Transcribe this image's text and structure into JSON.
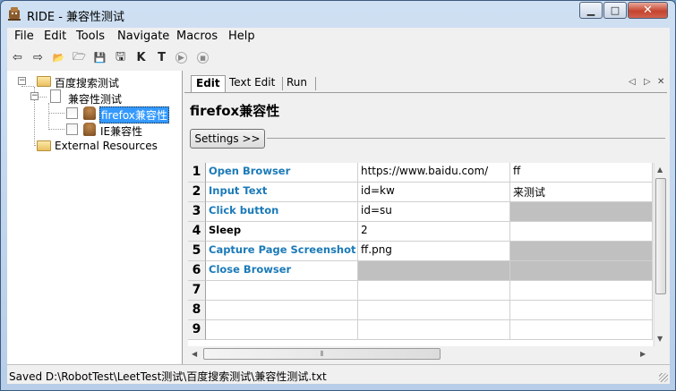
{
  "window": {
    "title": "RIDE - 兼容性测试",
    "min_glyph": "▁",
    "max_glyph": "□",
    "close_glyph": "✕"
  },
  "menu": [
    "File",
    "Edit",
    "Tools",
    "Navigate",
    "Macros",
    "Help"
  ],
  "toolbar": {
    "icons": [
      "back-arrow-icon",
      "forward-arrow-icon",
      "open-project-icon",
      "open-directory-icon",
      "save-icon",
      "save-all-icon",
      "search-keywords-icon",
      "search-tests-icon",
      "run-icon",
      "stop-icon"
    ],
    "glyphs": [
      "⇦",
      "⇨",
      "📂",
      "🗁",
      "💾",
      "🖫",
      "K",
      "T",
      "▶",
      "■"
    ]
  },
  "tree": {
    "root": "百度搜索测试",
    "suite": "兼容性测试",
    "tests": [
      "firefox兼容性",
      "IE兼容性"
    ],
    "external": "External Resources",
    "toggle_minus": "−"
  },
  "tabs": [
    "Edit",
    "Text Edit",
    "Run"
  ],
  "tab_nav": [
    "◁",
    "▷",
    "✕"
  ],
  "editor": {
    "title": "firefox兼容性",
    "settings_label": "Settings >>",
    "rows": [
      {
        "num": "1",
        "keyword": "Open Browser",
        "arg1": "https://www.baidu.com/",
        "arg2": "ff"
      },
      {
        "num": "2",
        "keyword": "Input Text",
        "arg1": "id=kw",
        "arg2": "来测试"
      },
      {
        "num": "3",
        "keyword": "Click button",
        "arg1": "id=su",
        "arg2": ""
      },
      {
        "num": "4",
        "keyword": "Sleep",
        "arg1": "2",
        "arg2": ""
      },
      {
        "num": "5",
        "keyword": "Capture Page Screenshot",
        "arg1": "ff.png",
        "arg2": ""
      },
      {
        "num": "6",
        "keyword": "Close Browser",
        "arg1": "",
        "arg2": ""
      },
      {
        "num": "7",
        "keyword": "",
        "arg1": "",
        "arg2": ""
      },
      {
        "num": "8",
        "keyword": "",
        "arg1": "",
        "arg2": ""
      },
      {
        "num": "9",
        "keyword": "",
        "arg1": "",
        "arg2": ""
      }
    ]
  },
  "scroll": {
    "hthumb_glyph": "⦀",
    "up": "▲",
    "down": "▼",
    "left": "◀",
    "right": "▶"
  },
  "status": "Saved D:\\RobotTest\\LeetTest测试\\百度搜索测试\\兼容性测试.txt"
}
